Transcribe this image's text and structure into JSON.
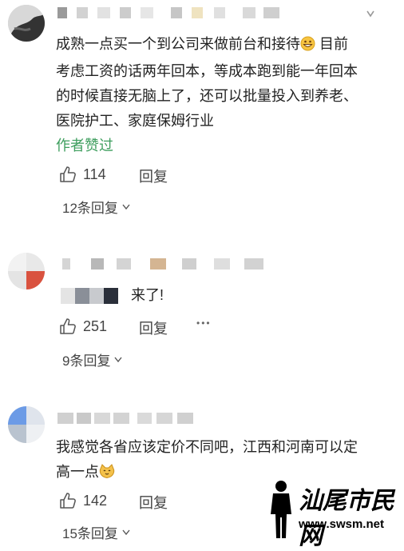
{
  "comments": [
    {
      "text": "成熟一点买一个到公司来做前台和接待😄 目前考虑工资的话两年回本，等成本跑到能一年回本的时候直接无脑上了，还可以批量投入到养老、医院护工、家庭保姆行业",
      "text_lines": [
        "成熟一点买一个到公司来做前台和接待",
        " 目前",
        "考虑工资的话两年回本，等成本跑到能一年回本",
        "的时候直接无脑上了，还可以批量投入到养老、",
        "医院护工、家庭保姆行业"
      ],
      "badge": "作者赞过",
      "likes": "114",
      "reply_label": "回复",
      "replies_toggle": "12条回复"
    },
    {
      "text": "来了!",
      "likes": "251",
      "reply_label": "回复",
      "more": "•••",
      "replies_toggle": "9条回复"
    },
    {
      "text_lines": [
        "我感觉各省应该定价不同吧，江西和河南可以定",
        "高一点"
      ],
      "likes": "142",
      "reply_label": "回复",
      "replies_toggle": "15条回复"
    }
  ],
  "watermark": {
    "site_name": "汕尾市民网",
    "url": "www.swsm.net"
  }
}
